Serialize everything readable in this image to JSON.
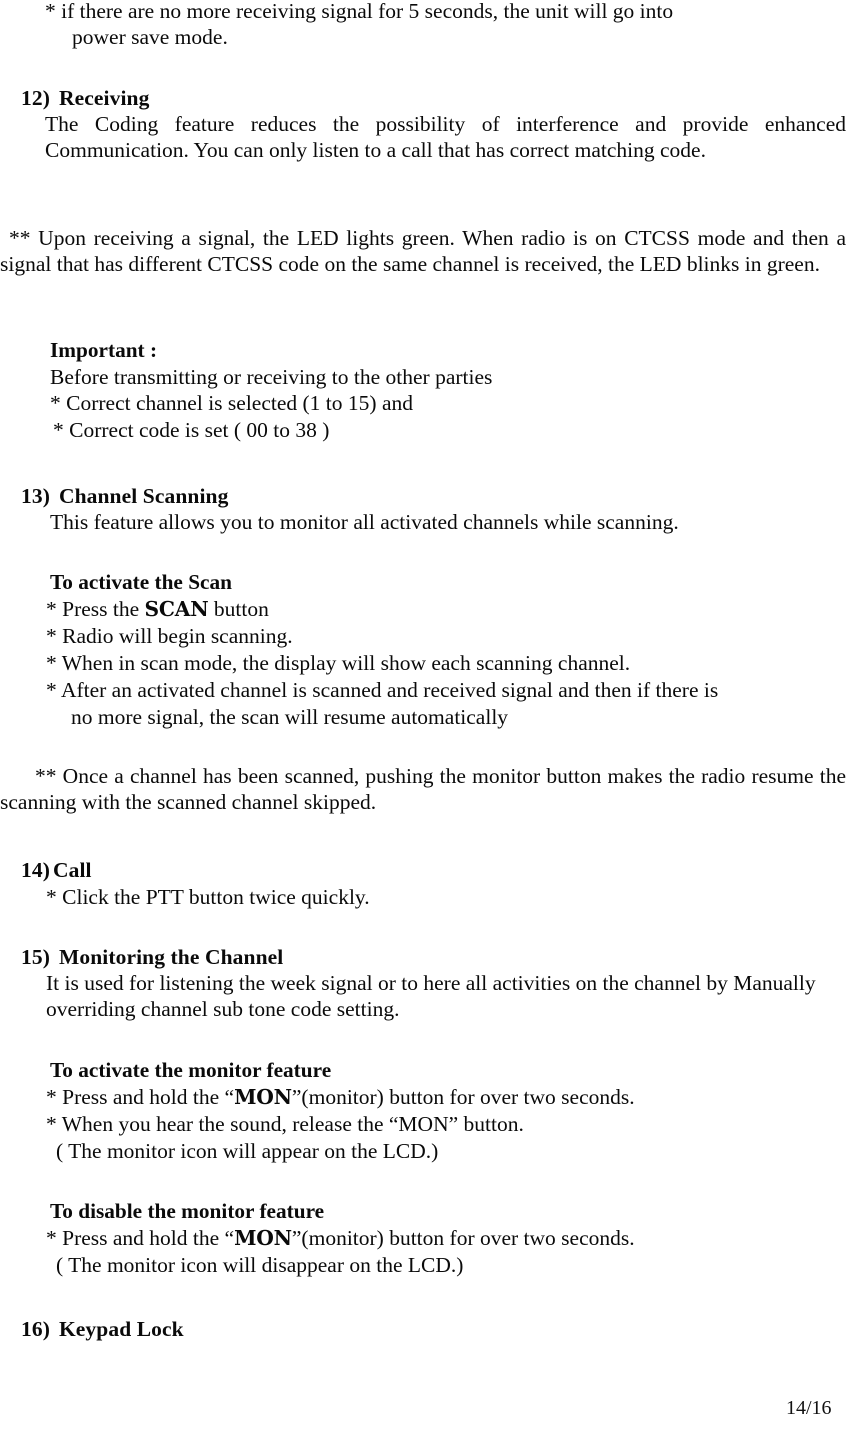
{
  "document": {
    "page_label": "14/16",
    "language": "en"
  },
  "top_continuation": {
    "line1": "* if there are no more receiving signal for 5 seconds, the unit will go into",
    "line2": "power save mode."
  },
  "sections": [
    {
      "number": "12)",
      "title": "Receiving",
      "body": "The Coding feature reduces the possibility of interference and provide enhanced Communication. You can only listen to a call that has correct matching code.",
      "note": "** Upon receiving a signal, the LED lights green. When radio is on CTCSS mode and then a signal that has different CTCSS code on the same channel is received, the LED blinks in green.",
      "callout": {
        "title": "Important :",
        "lead": "Before transmitting or receiving to the other parties",
        "items": [
          "* Correct channel is selected (1 to 15) and",
          "* Correct code is set ( 00 to 38 )"
        ]
      }
    },
    {
      "number": "13)",
      "title": "Channel Scanning",
      "body": "This feature allows you to monitor all activated channels while scanning.",
      "subheading": "To activate the Scan",
      "steps": [
        {
          "prefix": "* Press the ",
          "keyword": "SCAN",
          "suffix": " button"
        },
        {
          "prefix": "* Radio will begin scanning.",
          "keyword": "",
          "suffix": ""
        },
        {
          "prefix": "* When in scan mode, the display will show each scanning channel.",
          "keyword": "",
          "suffix": ""
        },
        {
          "prefix": "* After an activated channel is scanned and received signal and then if there is",
          "keyword": "",
          "suffix": ""
        },
        {
          "prefix": "no more signal, the scan will resume automatically",
          "keyword": "",
          "suffix": ""
        }
      ],
      "note": "** Once a channel has been scanned, pushing the monitor button makes the radio resume the scanning with the scanned channel skipped."
    },
    {
      "number": "14)",
      "title": "Call",
      "steps": [
        "* Click the PTT button twice quickly."
      ]
    },
    {
      "number": "15)",
      "title": "Monitoring the Channel",
      "body": "It is used for listening the week signal or to here all activities on the channel by Manually overriding channel sub tone code setting.",
      "activate": {
        "subheading": "To activate the monitor feature",
        "line1_prefix": "* Press and hold the “",
        "line1_keyword": "MON",
        "line1_suffix": "”(monitor) button for over two seconds.",
        "line2": "* When you hear the sound, release the “MON” button.",
        "line3": "( The monitor icon will appear on the LCD.)"
      },
      "disable": {
        "subheading": "To disable the monitor feature",
        "line1_prefix": "* Press and hold the “",
        "line1_keyword": "MON",
        "line1_suffix": "”(monitor) button for over two seconds.",
        "line2": "( The monitor icon will disappear on the LCD.)"
      }
    },
    {
      "number": "16)",
      "title": "Keypad Lock"
    }
  ]
}
